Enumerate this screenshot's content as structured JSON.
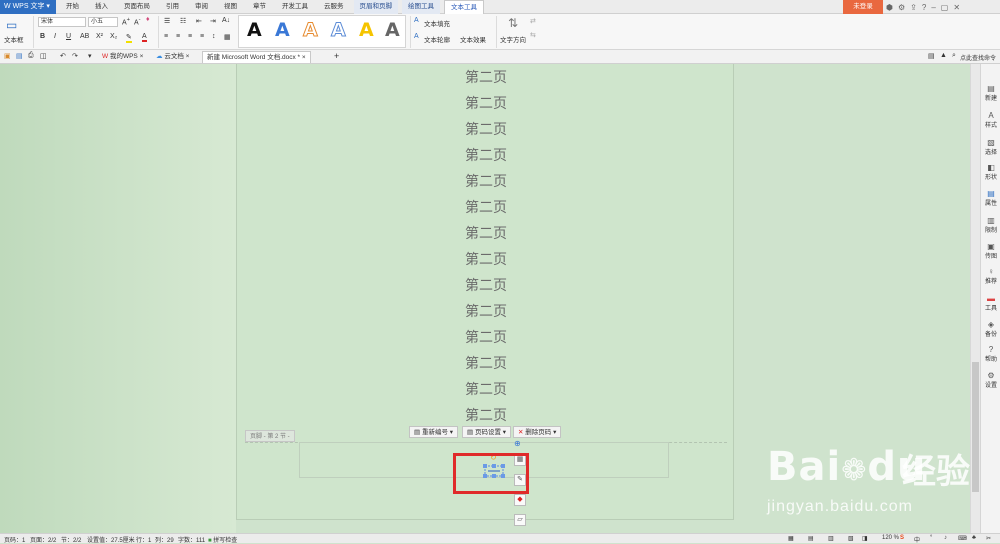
{
  "titlebar": {
    "app_name": "WPS 文字",
    "tabs": [
      "开始",
      "插入",
      "页面布局",
      "引用",
      "审阅",
      "视图",
      "章节",
      "开发工具",
      "云服务",
      "页眉和页脚",
      "绘图工具",
      "文本工具"
    ],
    "login": "未登录"
  },
  "ribbon": {
    "textbox_label": "文本框",
    "font_name": "宋体",
    "font_size": "小五",
    "text_fill": "文本填充",
    "text_outline": "文本轮廓",
    "text_effect": "文本效果",
    "text_direction": "文字方向",
    "style_glyph": "A"
  },
  "docbar": {
    "tab_wps": "我的WPS",
    "tab_cloud": "云文档",
    "tab_doc": "新建 Microsoft Word 文档.docx *",
    "search_hint": "点此查找命令"
  },
  "document": {
    "lines": [
      "第二页",
      "第二页",
      "第二页",
      "第二页",
      "第二页",
      "第二页",
      "第二页",
      "第二页",
      "第二页",
      "第二页",
      "第二页",
      "第二页",
      "第二页",
      "第二页"
    ],
    "footer_label": "页脚 - 第 2 节 -",
    "btn_renumber": "重新编号",
    "btn_page_setup": "页码设置",
    "btn_delete_page_num": "删除页码"
  },
  "rightpanel": [
    "新建",
    "样式",
    "选择",
    "形状",
    "属性",
    "限制",
    "传图",
    "推荐",
    "工具",
    "备份",
    "帮助",
    "设置"
  ],
  "status": {
    "page_num": "页码：1",
    "pages": "页面：2/2",
    "section": "节：2/2",
    "setting": "设置值：27.5厘米",
    "row": "行：1",
    "col": "列：29",
    "words": "字数：111",
    "spell": "拼写检查",
    "zoom": "120 %"
  },
  "watermark": {
    "brand": "Bai",
    "brand2": "du",
    "cn": "经验",
    "url": "jingyan.baidu.com"
  }
}
